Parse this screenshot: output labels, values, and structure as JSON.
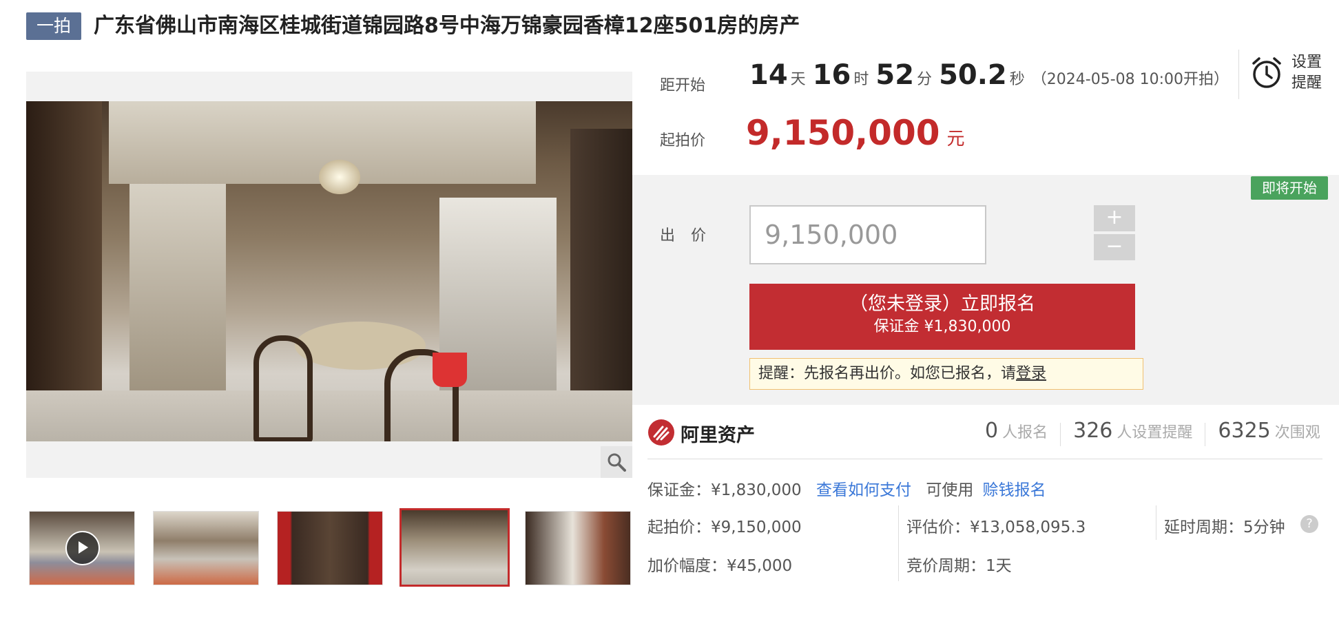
{
  "header": {
    "badge": "一拍",
    "title": "广东省佛山市南海区桂城街道锦园路8号中海万锦豪园香樟12座501房的房产"
  },
  "countdown": {
    "label": "距开始",
    "days": "14",
    "days_unit": "天",
    "hours": "16",
    "hours_unit": "时",
    "minutes": "52",
    "minutes_unit": "分",
    "seconds": "50.2",
    "seconds_unit": "秒",
    "start_time": "（2024-05-08 10:00开拍）"
  },
  "reminder": {
    "line1": "设置",
    "line2": "提醒",
    "icon": "alarm-clock-icon"
  },
  "start_price": {
    "label": "起拍价",
    "value": "9,150,000",
    "unit": "元"
  },
  "bid": {
    "status_badge": "即将开始",
    "label": "出 价",
    "input_value": "9,150,000",
    "plus": "+",
    "minus": "−"
  },
  "signup": {
    "line1": "（您未登录）立即报名",
    "line2": "保证金 ¥1,830,000"
  },
  "tip": {
    "text": "提醒：先报名再出价。如您已报名，请",
    "link": "登录"
  },
  "platform": {
    "name": "阿里资产"
  },
  "stats": {
    "signups": "0",
    "signups_unit": "人报名",
    "reminders": "326",
    "reminders_unit": "人设置提醒",
    "views": "6325",
    "views_unit": "次围观"
  },
  "details": {
    "deposit": "保证金：¥1,830,000",
    "how_to_pay": "查看如何支付",
    "can_use": "可使用",
    "earn_signup": "赊钱报名",
    "start_price": "起拍价：¥9,150,000",
    "appraisal": "评估价：¥13,058,095.3",
    "extension": "延时周期：5分钟",
    "increment": "加价幅度：¥45,000",
    "cycle": "竞价周期：1天",
    "help": "?"
  },
  "colors": {
    "accent": "#c22d32",
    "badge": "#5b7094",
    "green": "#4aa35d",
    "link": "#3b78d8"
  }
}
